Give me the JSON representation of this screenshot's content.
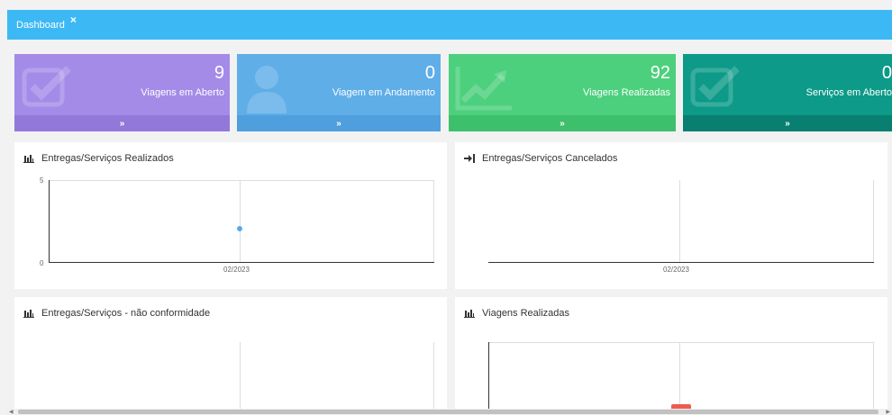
{
  "tab": {
    "label": "Dashboard",
    "close": "×"
  },
  "cards": [
    {
      "value": "9",
      "label": "Viagens em Aberto",
      "footer": "»",
      "color": "#a48be8",
      "footer_color": "#9278d9",
      "icon": "checkbox-icon"
    },
    {
      "value": "0",
      "label": "Viagem em Andamento",
      "footer": "»",
      "color": "#5faee8",
      "footer_color": "#4f9ede",
      "icon": "user-icon"
    },
    {
      "value": "92",
      "label": "Viagens Realizadas",
      "footer": "»",
      "color": "#4cd07d",
      "footer_color": "#3dbf6c",
      "icon": "trend-icon"
    },
    {
      "value": "0",
      "label": "Serviços em Aberto",
      "footer": "»",
      "color": "#0d9a88",
      "footer_color": "#087f70",
      "icon": "checkbox-icon"
    }
  ],
  "panels": {
    "realizados": {
      "title": "Entregas/Serviços Realizados",
      "y_top": "5",
      "y_bottom": "0",
      "x_label": "02/2023"
    },
    "cancelados": {
      "title": "Entregas/Serviços Cancelados",
      "x_label": "02/2023"
    },
    "nao_conformidade": {
      "title": "Entregas/Serviços - não conformidade"
    },
    "viagens": {
      "title": "Viagens Realizadas"
    }
  },
  "chart_data": [
    {
      "type": "scatter",
      "title": "Entregas/Serviços Realizados",
      "x": [
        "02/2023"
      ],
      "values": [
        2
      ],
      "ylim": [
        0,
        5
      ]
    },
    {
      "type": "line",
      "title": "Entregas/Serviços Cancelados",
      "x": [
        "02/2023"
      ],
      "values": []
    },
    {
      "type": "line",
      "title": "Entregas/Serviços - não conformidade",
      "x": [],
      "values": []
    },
    {
      "type": "bar",
      "title": "Viagens Realizadas",
      "x": [],
      "values": []
    }
  ]
}
